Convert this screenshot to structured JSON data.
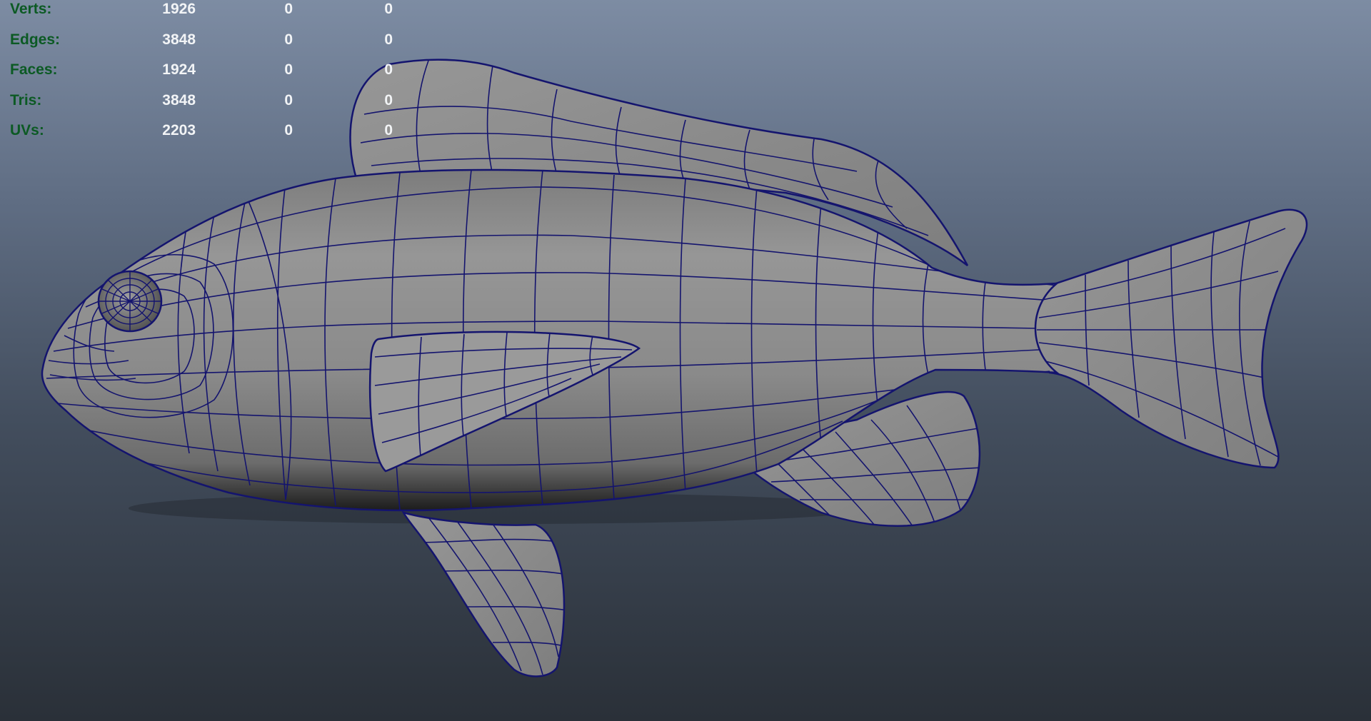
{
  "heads_up_display": {
    "rows": [
      {
        "label": "Verts:",
        "values": [
          "1926",
          "0",
          "0"
        ]
      },
      {
        "label": "Edges:",
        "values": [
          "3848",
          "0",
          "0"
        ]
      },
      {
        "label": "Faces:",
        "values": [
          "1924",
          "0",
          "0"
        ]
      },
      {
        "label": "Tris:",
        "values": [
          "3848",
          "0",
          "0"
        ]
      },
      {
        "label": "UVs:",
        "values": [
          "2203",
          "0",
          "0"
        ]
      }
    ]
  },
  "viewport": {
    "object": "fish-mesh",
    "display_mode": "shaded-wireframe",
    "wireframe_color": "#14146e",
    "surface_color": "#8a8a8a",
    "label_color": "#0c5a24",
    "value_color": "#f2f4f6"
  }
}
